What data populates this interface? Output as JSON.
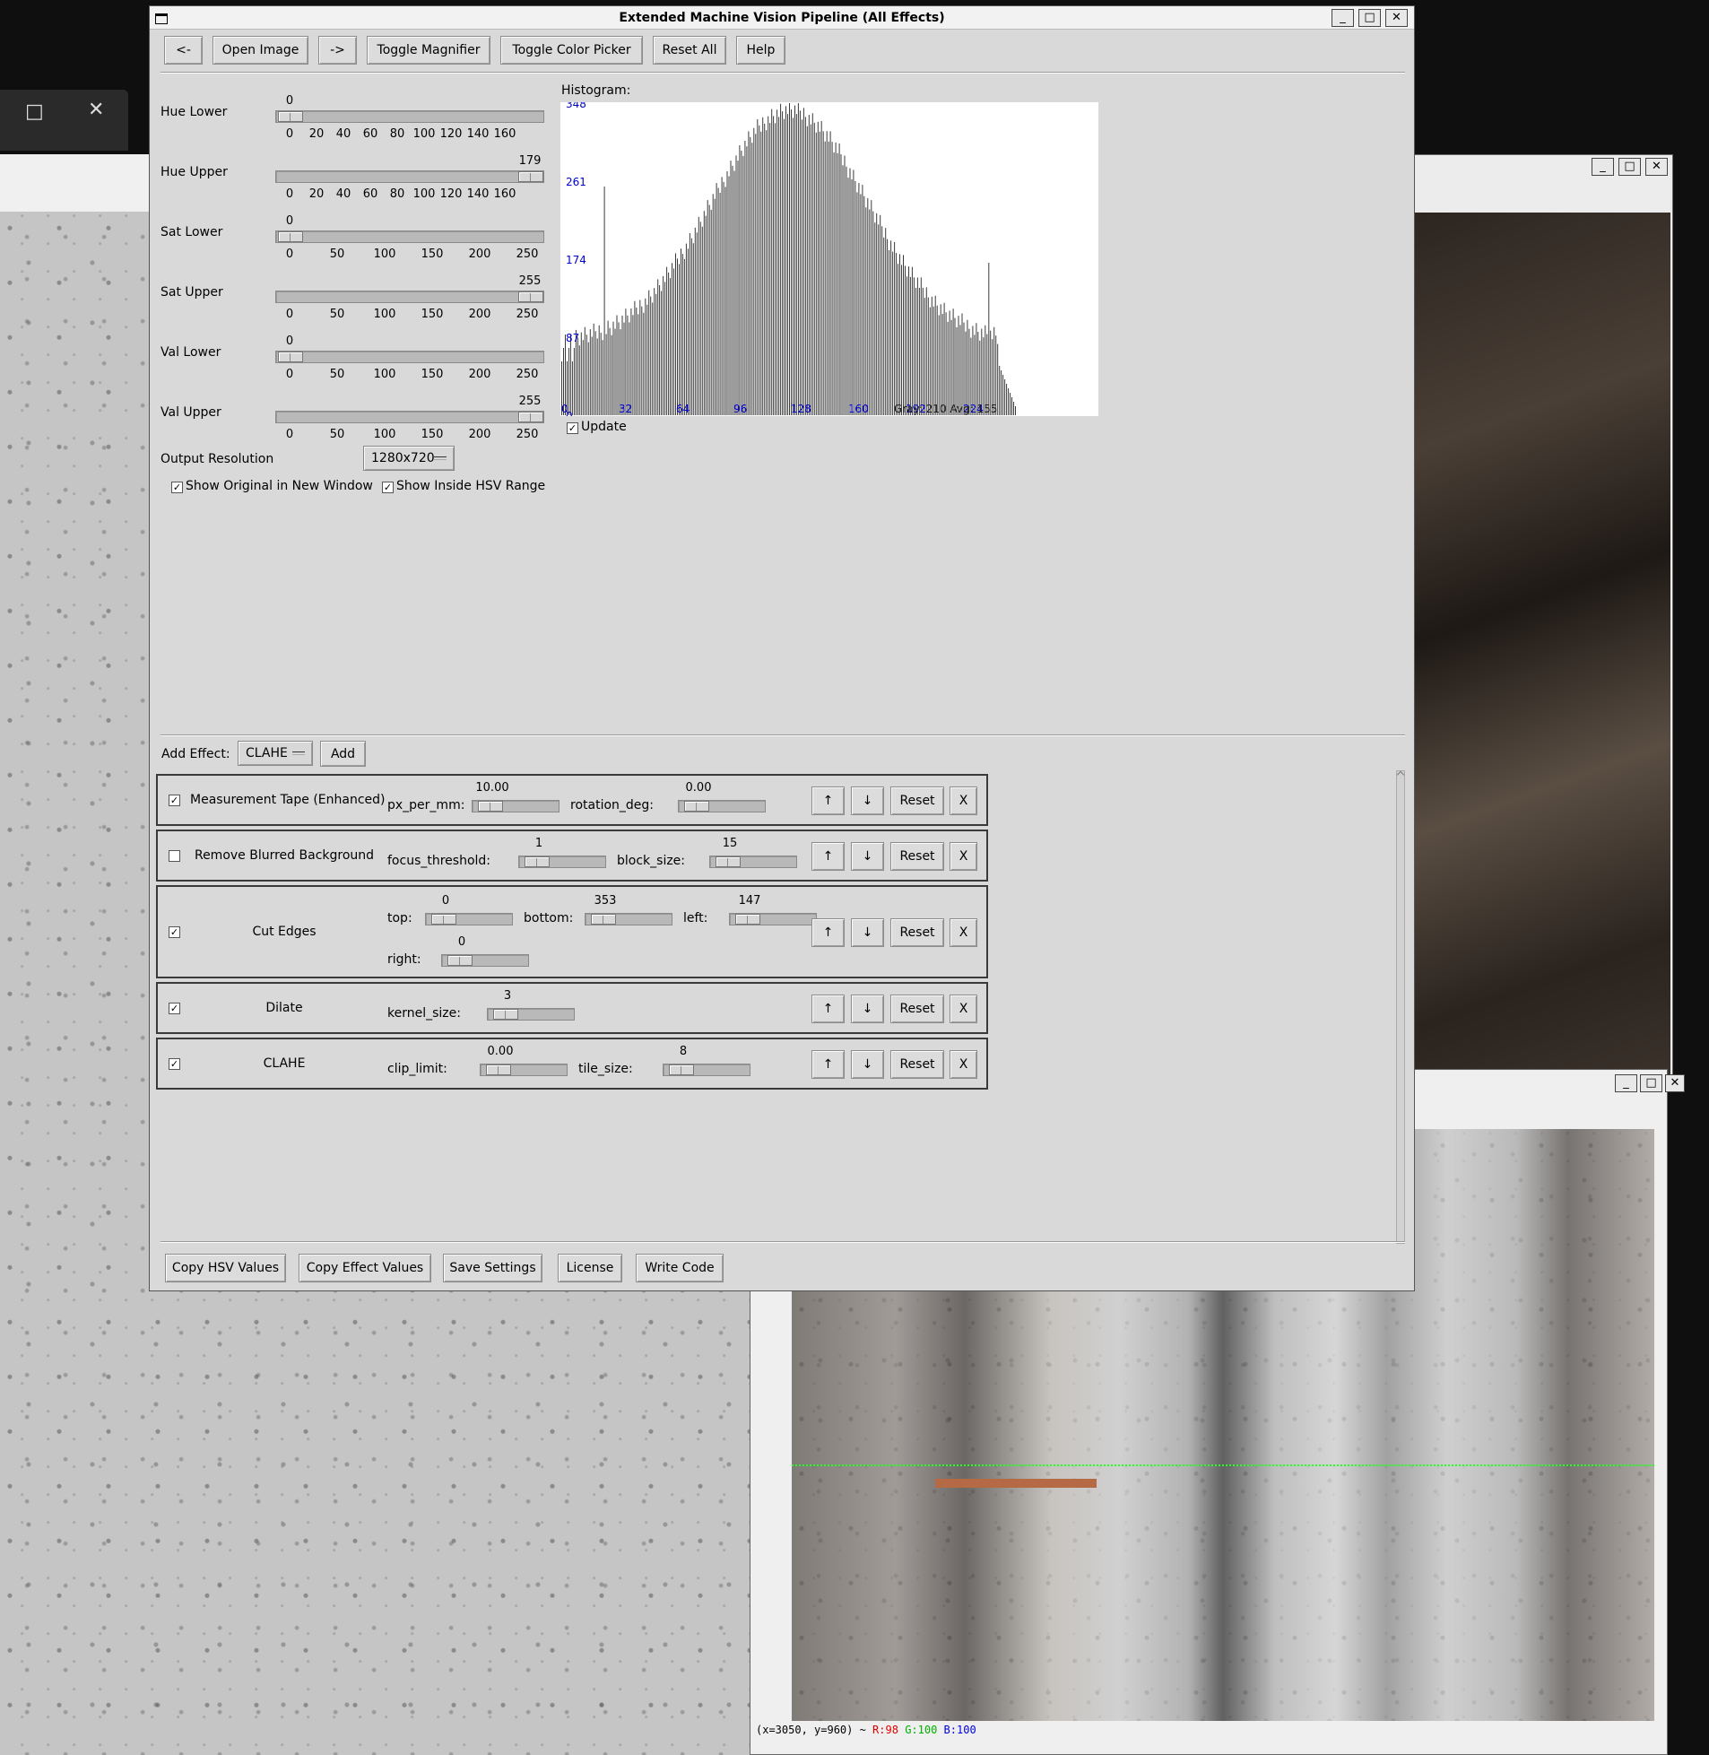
{
  "main_window": {
    "title": "Extended Machine Vision Pipeline (All Effects)",
    "toolbar": {
      "back_label": "<-",
      "open_image_label": "Open Image",
      "forward_label": "->",
      "toggle_magnifier_label": "Toggle Magnifier",
      "toggle_color_picker_label": "Toggle Color Picker",
      "reset_all_label": "Reset All",
      "help_label": "Help"
    },
    "hsv_sliders": [
      {
        "label": "Hue Lower",
        "value": "0",
        "ticks": [
          "0",
          "20",
          "40",
          "60",
          "80",
          "100",
          "120",
          "140",
          "160"
        ],
        "fraction": 0.0
      },
      {
        "label": "Hue Upper",
        "value": "179",
        "ticks": [
          "0",
          "20",
          "40",
          "60",
          "80",
          "100",
          "120",
          "140",
          "160"
        ],
        "fraction": 1.0
      },
      {
        "label": "Sat Lower",
        "value": "0",
        "ticks": [
          "0",
          "50",
          "100",
          "150",
          "200",
          "250"
        ],
        "fraction": 0.0
      },
      {
        "label": "Sat Upper",
        "value": "255",
        "ticks": [
          "0",
          "50",
          "100",
          "150",
          "200",
          "250"
        ],
        "fraction": 1.0
      },
      {
        "label": "Val Lower",
        "value": "0",
        "ticks": [
          "0",
          "50",
          "100",
          "150",
          "200",
          "250"
        ],
        "fraction": 0.0
      },
      {
        "label": "Val Upper",
        "value": "255",
        "ticks": [
          "0",
          "50",
          "100",
          "150",
          "200",
          "250"
        ],
        "fraction": 1.0
      }
    ],
    "output_resolution": {
      "label": "Output Resolution",
      "value": "1280x720"
    },
    "show_original": {
      "label": "Show Original in New Window",
      "checked": true
    },
    "show_inside_hsv": {
      "label": "Show Inside HSV Range",
      "checked": true
    },
    "histogram": {
      "label": "Histogram:",
      "y_ticks": [
        "348",
        "261",
        "174",
        "87",
        "0"
      ],
      "x_ticks": [
        "0",
        "32",
        "64",
        "96",
        "128",
        "160",
        "192",
        "224"
      ],
      "stats_text": "Gray: 210  Avg: 155",
      "update_label": "Update",
      "update_checked": true,
      "bar_color": "#3a3a3a",
      "tick_color": "#0000cc"
    },
    "add_effect": {
      "label": "Add Effect:",
      "selected": "CLAHE",
      "add_label": "Add"
    },
    "effects": [
      {
        "enabled": true,
        "name": "Measurement Tape (Enhanced)",
        "params": [
          {
            "name": "px_per_mm:",
            "value": "10.00"
          },
          {
            "name": "rotation_deg:",
            "value": "0.00"
          }
        ]
      },
      {
        "enabled": false,
        "name": "Remove Blurred Background",
        "params": [
          {
            "name": "focus_threshold:",
            "value": "1"
          },
          {
            "name": "block_size:",
            "value": "15"
          }
        ]
      },
      {
        "enabled": true,
        "name": "Cut Edges",
        "params": [
          {
            "name": "top:",
            "value": "0"
          },
          {
            "name": "bottom:",
            "value": "353"
          },
          {
            "name": "left:",
            "value": "147"
          },
          {
            "name": "right:",
            "value": "0"
          }
        ]
      },
      {
        "enabled": true,
        "name": "Dilate",
        "params": [
          {
            "name": "kernel_size:",
            "value": "3"
          }
        ]
      },
      {
        "enabled": true,
        "name": "CLAHE",
        "params": [
          {
            "name": "clip_limit:",
            "value": "0.00"
          },
          {
            "name": "tile_size:",
            "value": "8"
          }
        ]
      }
    ],
    "effect_controls": {
      "up": "↑",
      "down": "↓",
      "reset": "Reset",
      "remove": "X"
    },
    "bottom_buttons": {
      "copy_hsv": "Copy HSV Values",
      "copy_effect": "Copy Effect Values",
      "save_settings": "Save Settings",
      "license": "License",
      "write_code": "Write Code"
    },
    "window_controls": {
      "minimize": "_",
      "maximize": "□",
      "close": "✕"
    }
  },
  "output_window": {
    "status": {
      "prefix": "(x=3050, y=960) ~ ",
      "r": "R:98",
      "g": "G:100",
      "b": "B:100"
    },
    "ruler_color": "#22ff22"
  },
  "background_window": {
    "maximize": "□",
    "close": "✕"
  }
}
